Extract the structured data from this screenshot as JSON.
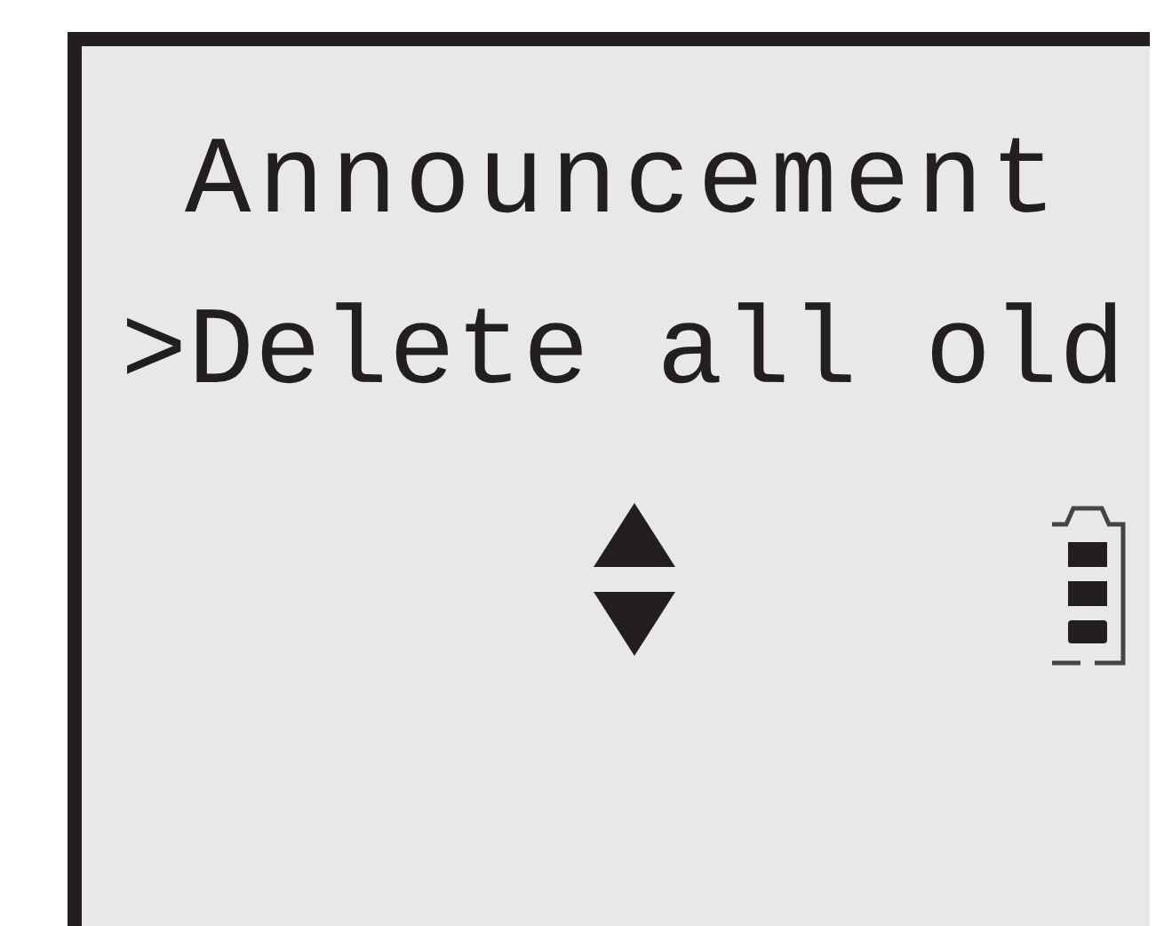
{
  "display": {
    "title": "Announcement",
    "menu_line": ">Delete all old"
  }
}
